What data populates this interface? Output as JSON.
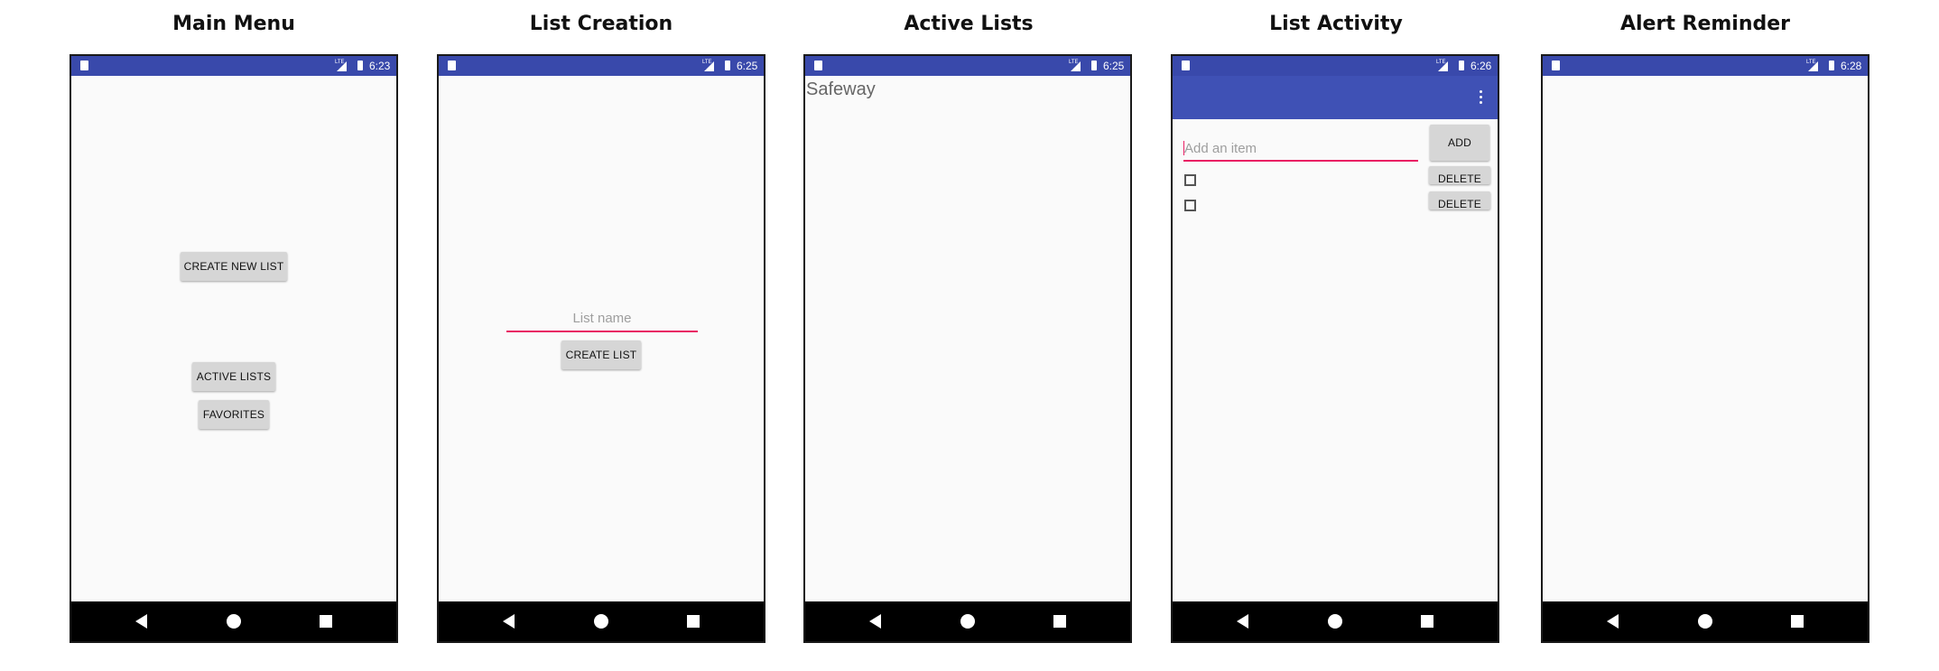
{
  "titles": {
    "main_menu": "Main Menu",
    "list_creation": "List Creation",
    "active_lists": "Active Lists",
    "list_activity": "List Activity",
    "alert_reminder": "Alert Reminder"
  },
  "status_times": {
    "main_menu": "6:23",
    "list_creation": "6:25",
    "active_lists": "6:25",
    "list_activity": "6:26",
    "alert_reminder": "6:28"
  },
  "status_lte": "LTE",
  "main_menu": {
    "create_new_list": "CREATE NEW LIST",
    "active_lists": "ACTIVE LISTS",
    "favorites": "FAVORITES"
  },
  "list_creation": {
    "list_name_placeholder": "List name",
    "create_list": "CREATE LIST"
  },
  "active_lists": {
    "items": [
      "Safeway"
    ]
  },
  "list_activity": {
    "add_placeholder": "Add an item",
    "add_button": "ADD",
    "delete_button": "DELETE"
  },
  "colors": {
    "status_bar": "#3949ab",
    "app_bar": "#3f51b5",
    "accent": "#e91e63"
  },
  "icons": [
    "sd-card-icon",
    "signal-icon",
    "battery-icon",
    "back-icon",
    "home-icon",
    "recents-icon",
    "overflow-menu-icon",
    "checkbox-icon"
  ]
}
